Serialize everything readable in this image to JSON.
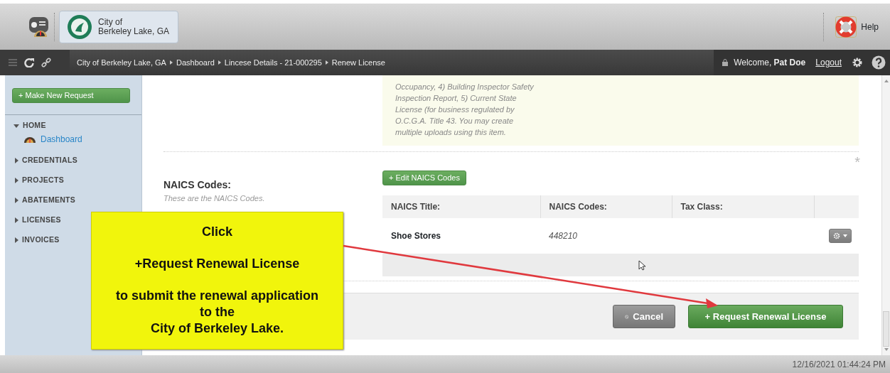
{
  "header": {
    "org_name": "City of\nBerkeley Lake, GA",
    "help": "Help"
  },
  "navbar": {
    "breadcrumb": [
      "City of Berkeley Lake, GA",
      "Dashboard",
      "Lincese Details - 21-000295",
      "Renew License"
    ],
    "welcome": "Welcome, **Pat Doe**",
    "logout": "Logout"
  },
  "sidebar": {
    "new_request": "+ Make New Request",
    "items": [
      {
        "label": "HOME",
        "expanded": true,
        "children": [
          {
            "label": "Dashboard"
          }
        ]
      },
      {
        "label": "CREDENTIALS",
        "expanded": false
      },
      {
        "label": "PROJECTS",
        "expanded": false
      },
      {
        "label": "ABATEMENTS",
        "expanded": false
      },
      {
        "label": "LICENSES",
        "expanded": false
      },
      {
        "label": "INVOICES",
        "expanded": false
      }
    ]
  },
  "upload_note": "Occupancy, 4) Building Inspector Safety\nInspection Report, 5) Current State\nLicense (for business regulated by\nO.C.G.A. Title 43. You may create\nmultiple uploads using this item.",
  "naics": {
    "required_mark": "*",
    "label": "NAICS Codes:",
    "hint": "These are the NAICS Codes.",
    "edit_button": "+ Edit NAICS Codes",
    "columns": [
      "NAICS Title:",
      "NAICS Codes:",
      "Tax Class:"
    ],
    "rows": [
      {
        "naics_title": "Shoe Stores",
        "naics_code": "448210"
      }
    ]
  },
  "actions": {
    "cancel": "Cancel",
    "submit": "+ Request Renewal License"
  },
  "callout": {
    "paragraphs": [
      "Click",
      "+Request Renewal License",
      "to submit the renewal application\nto the\nCity of Berkeley Lake."
    ]
  },
  "status_bar": {
    "timestamp": "12/16/2021 01:44:24 PM"
  }
}
